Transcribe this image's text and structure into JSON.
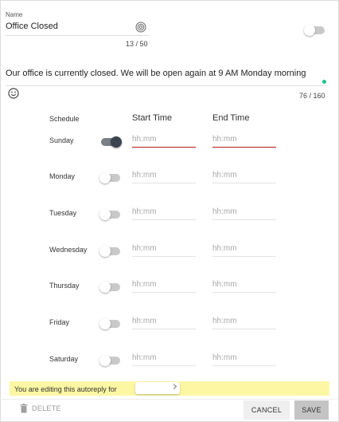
{
  "name_field": {
    "label": "Name",
    "value": "Office Closed",
    "counter": "13 / 50"
  },
  "message": {
    "text": "Our office is currently closed. We will be open again at 9 AM Monday morning",
    "counter": "76 / 160"
  },
  "schedule": {
    "header": "Schedule",
    "start_header": "Start Time",
    "end_header": "End Time",
    "placeholder": "hh:mm",
    "days": [
      {
        "name": "Sunday",
        "enabled": true
      },
      {
        "name": "Monday",
        "enabled": false
      },
      {
        "name": "Tuesday",
        "enabled": false
      },
      {
        "name": "Wednesday",
        "enabled": false
      },
      {
        "name": "Thursday",
        "enabled": false
      },
      {
        "name": "Friday",
        "enabled": false
      },
      {
        "name": "Saturday",
        "enabled": false
      }
    ]
  },
  "banner": {
    "text": "You are editing this autoreply for"
  },
  "footer": {
    "delete_label": "DELETE",
    "cancel_label": "CANCEL",
    "save_label": "SAVE"
  },
  "colors": {
    "error_underline": "#b71c1c",
    "banner_bg": "#fdf7a4",
    "status_dot": "#1ec28b"
  },
  "icons": {
    "name_field_icon": "fingerprint-icon",
    "emoji_icon": "emoji-smile-icon",
    "delete_icon": "trash-icon"
  }
}
